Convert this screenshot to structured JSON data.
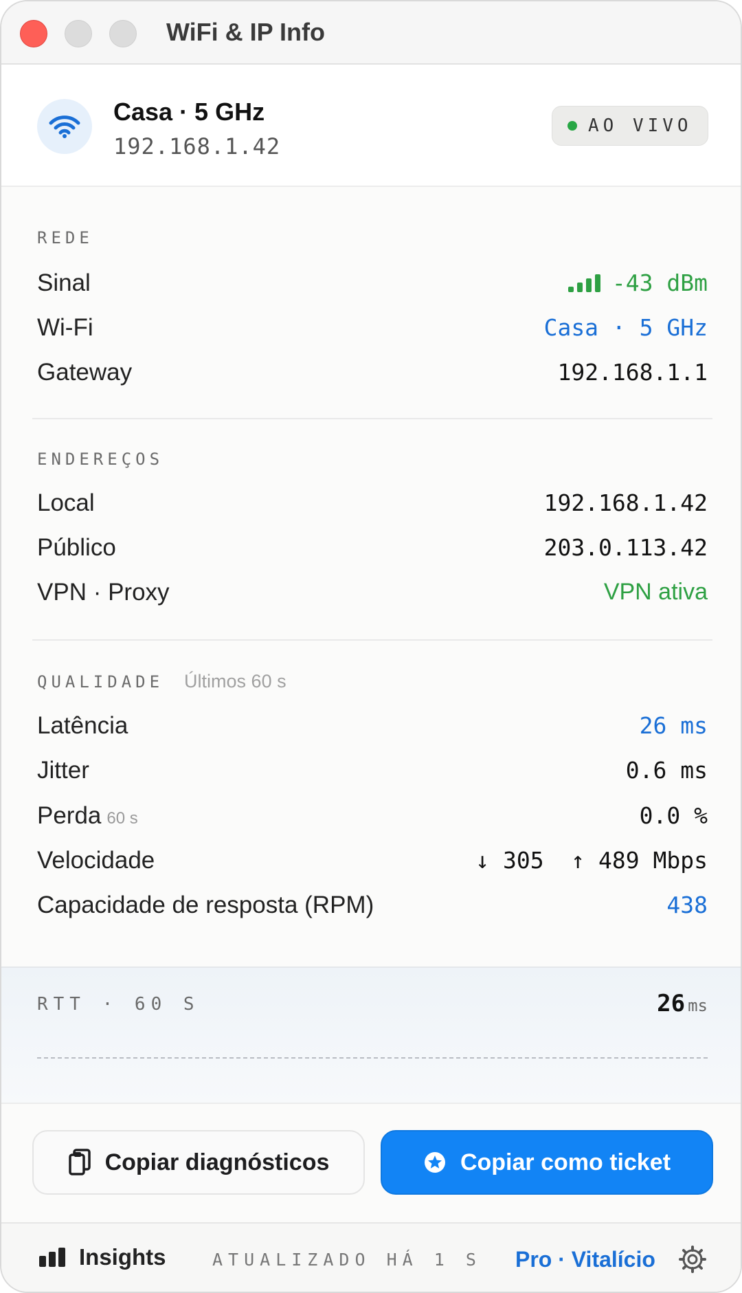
{
  "window": {
    "title": "WiFi & IP Info"
  },
  "header": {
    "network_name": "Casa · 5 GHz",
    "ip": "192.168.1.42",
    "live_badge": "AO VIVO"
  },
  "rede": {
    "title": "REDE",
    "rows": [
      {
        "label": "Sinal",
        "value": "-43 dBm"
      },
      {
        "label": "Wi-Fi",
        "value": "Casa · 5 GHz"
      },
      {
        "label": "Gateway",
        "value": "192.168.1.1"
      }
    ]
  },
  "enderecos": {
    "title": "ENDEREÇOS",
    "rows": [
      {
        "label": "Local",
        "value": "192.168.1.42"
      },
      {
        "label": "Público",
        "value": "203.0.113.42"
      },
      {
        "label": "VPN · Proxy",
        "value": "VPN ativa"
      }
    ]
  },
  "qualidade": {
    "title": "QUALIDADE",
    "subtitle": "Últimos 60 s",
    "rows": [
      {
        "label": "Latência",
        "value": "26 ms"
      },
      {
        "label": "Jitter",
        "value": "0.6 ms"
      },
      {
        "label": "Perda",
        "hint": "60 s",
        "value": "0.0 %"
      },
      {
        "label": "Velocidade",
        "value": "↓ 305  ↑ 489 Mbps"
      },
      {
        "label": "Capacidade de resposta (RPM)",
        "value": "438"
      }
    ]
  },
  "rtt": {
    "label": "RTT · 60 S",
    "value": "26",
    "unit": "ms"
  },
  "buttons": {
    "copy_diagnostics": "Copiar diagnósticos",
    "copy_ticket": "Copiar como ticket"
  },
  "footer": {
    "insights": "Insights",
    "updated": "ATUALIZADO HÁ 1 S",
    "plan": "Pro · Vitalício"
  },
  "colors": {
    "accent": "#1284f5",
    "link_blue": "#1a6fd6",
    "good_green": "#2ea043",
    "close_red": "#fe5f57"
  },
  "icons": [
    "wifi-icon",
    "signal-bars-icon",
    "clipboard-icon",
    "star-badge-icon",
    "chart-bars-icon",
    "gear-icon"
  ]
}
